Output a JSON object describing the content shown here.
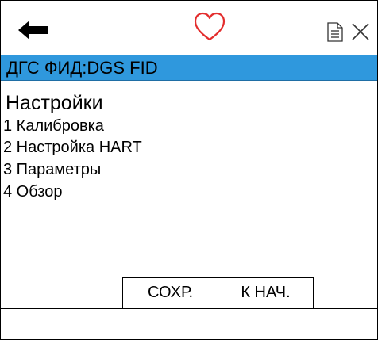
{
  "header": {
    "icons": [
      "arrow-left-icon",
      "heart-icon",
      "document-icon",
      "close-icon"
    ],
    "heart_color": "#e32d2d"
  },
  "title_bar": {
    "text": "ДГС ФИД:DGS FID",
    "color": "#2f98dd"
  },
  "menu": {
    "heading": "Настройки",
    "items": [
      {
        "label": "1 Калибровка"
      },
      {
        "label": "2 Настройка HART"
      },
      {
        "label": "3 Параметры"
      },
      {
        "label": "4 Обзор"
      }
    ]
  },
  "buttons": {
    "save_label": "СОХР.",
    "home_label": "К НАЧ."
  },
  "status_bar": {
    "text": ""
  }
}
